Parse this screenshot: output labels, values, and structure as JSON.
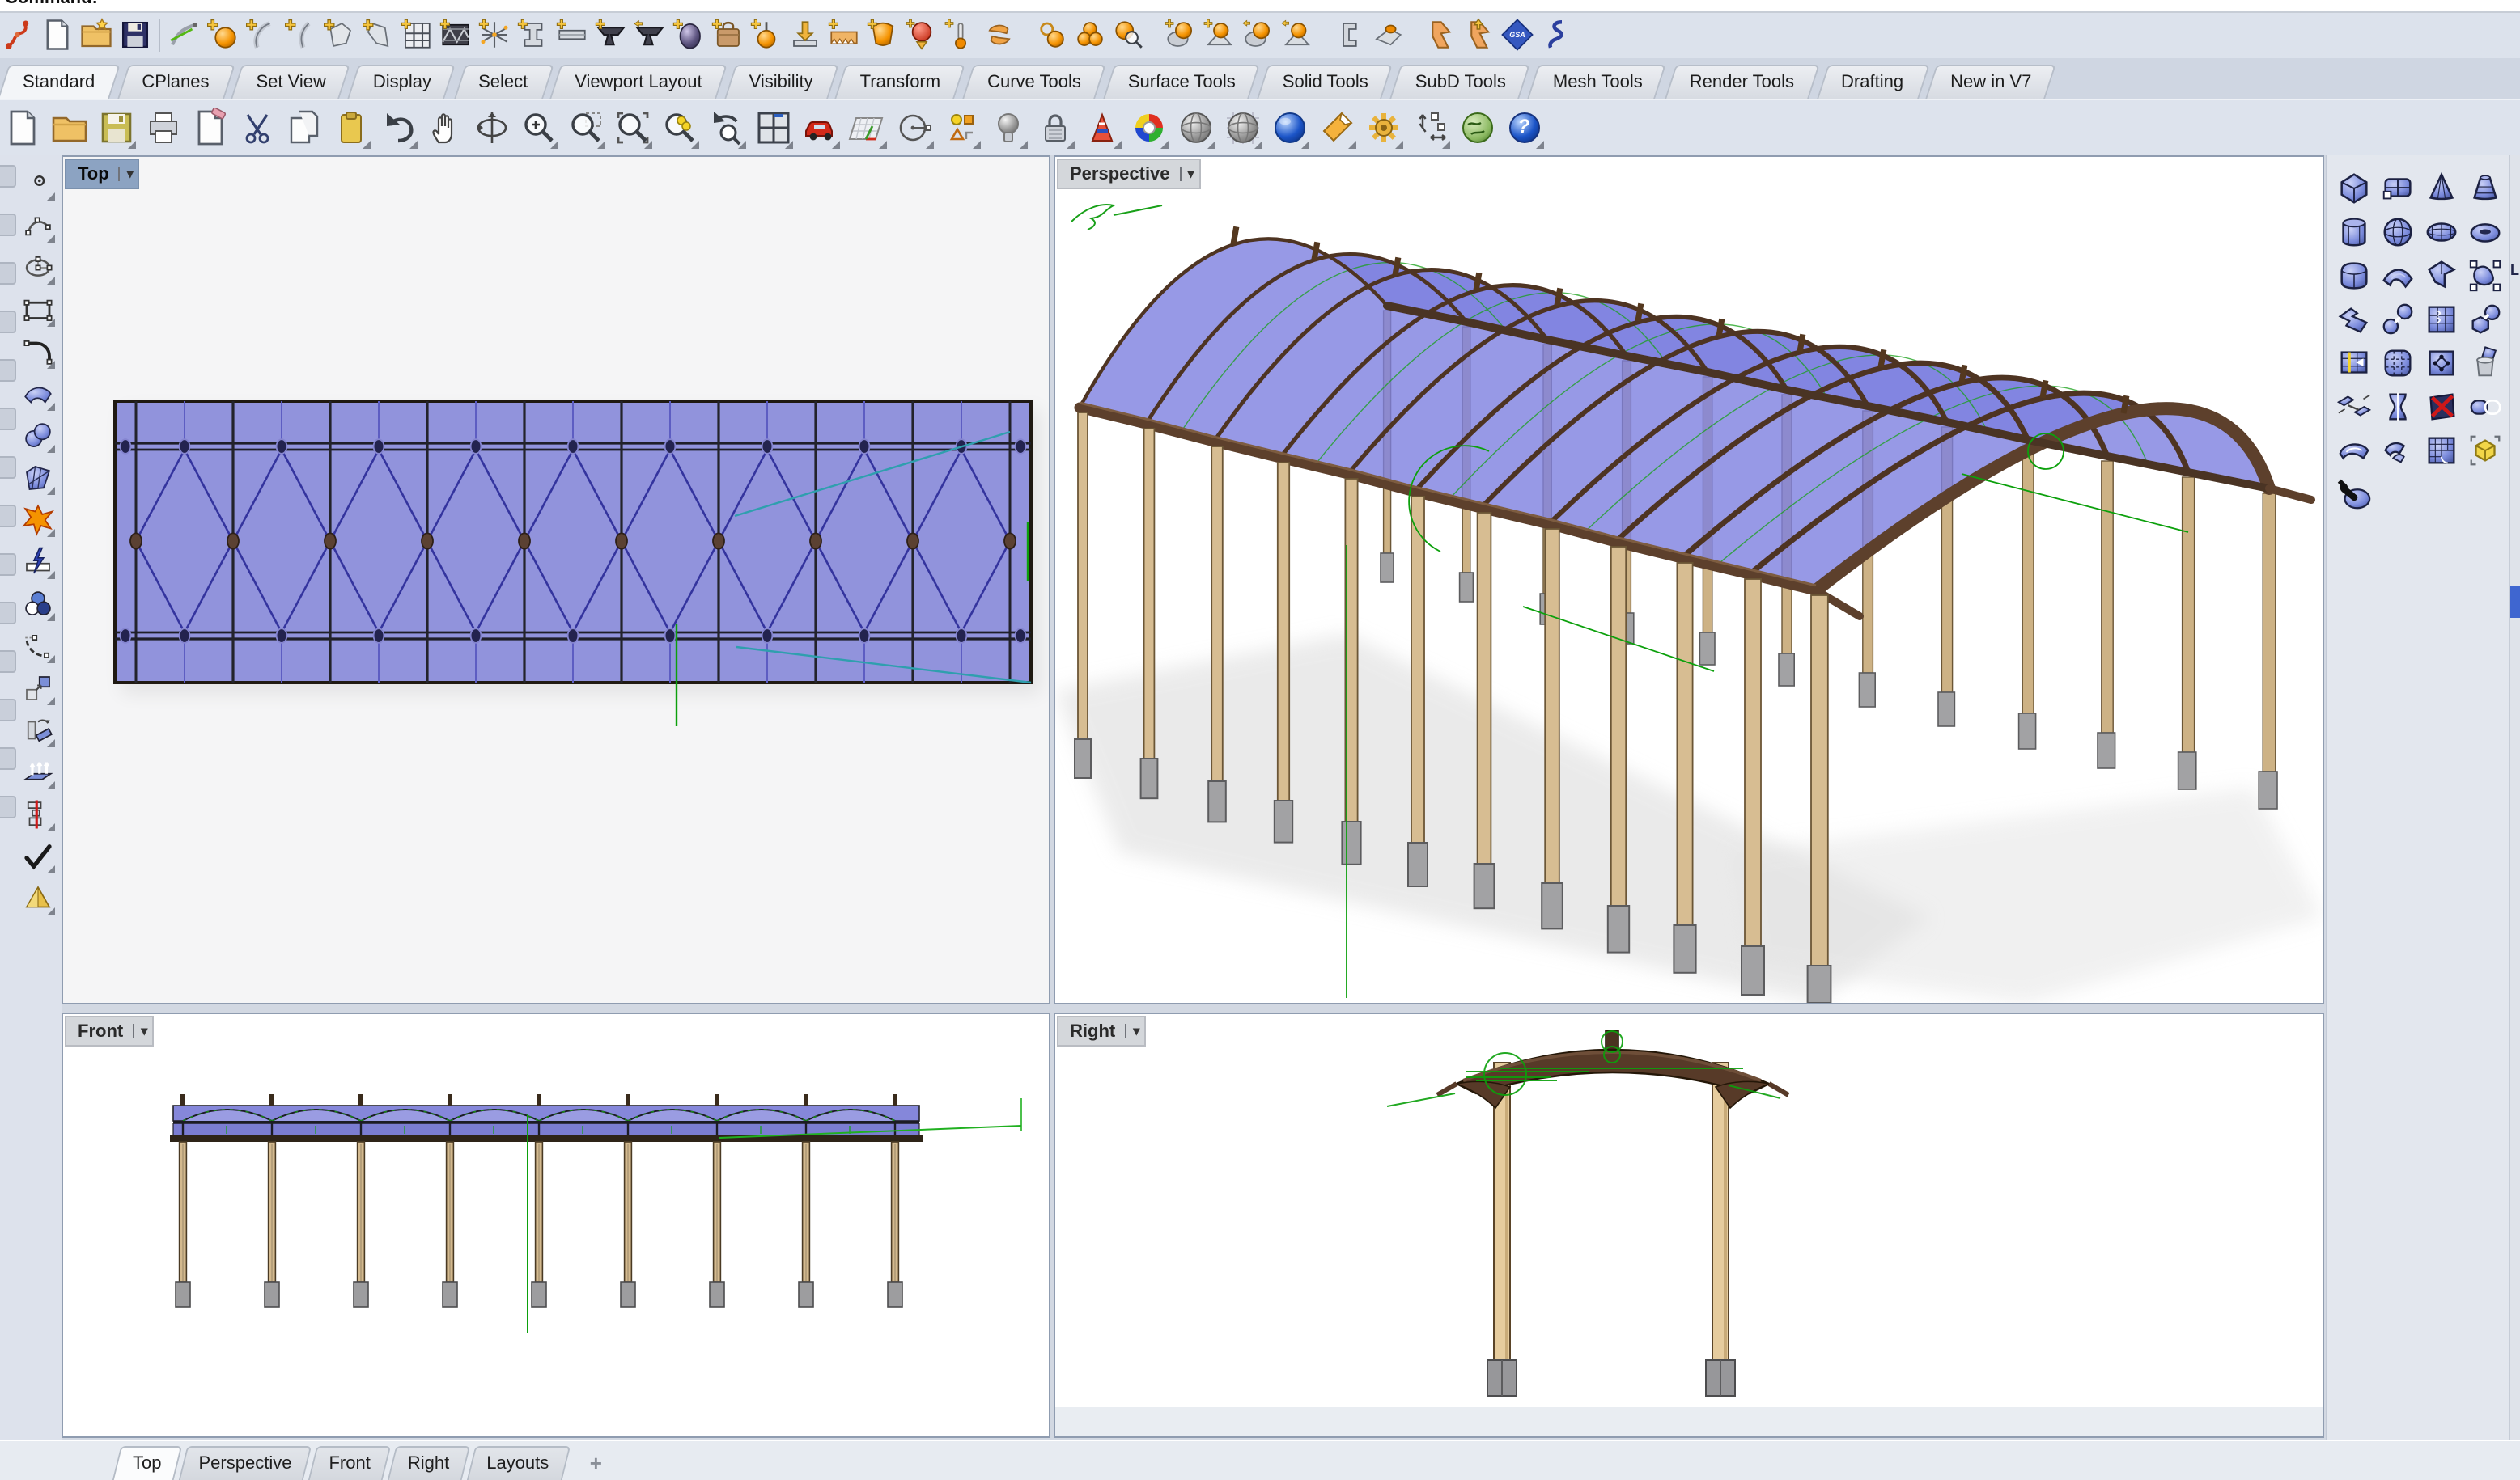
{
  "window": {
    "command_label": "Command:"
  },
  "ribbon": {
    "tabs": [
      {
        "label": "Standard",
        "active": true
      },
      {
        "label": "CPlanes"
      },
      {
        "label": "Set View"
      },
      {
        "label": "Display"
      },
      {
        "label": "Select"
      },
      {
        "label": "Viewport Layout"
      },
      {
        "label": "Visibility"
      },
      {
        "label": "Transform"
      },
      {
        "label": "Curve Tools"
      },
      {
        "label": "Surface Tools"
      },
      {
        "label": "Solid Tools"
      },
      {
        "label": "SubD Tools"
      },
      {
        "label": "Mesh Tools"
      },
      {
        "label": "Render Tools"
      },
      {
        "label": "Drafting"
      },
      {
        "label": "New in V7"
      }
    ]
  },
  "toolbar_row1": {
    "gsa_label": "GSA",
    "icons": [
      "red-plugin",
      "new-file",
      "open-folder",
      "save",
      "curve-edit",
      "point-add",
      "curve-add",
      "interp-curve-add",
      "polygon-add",
      "surface-add",
      "grid-frame-add",
      "truss-panel",
      "truss-network-add",
      "ibeam-add",
      "ibeam-profile-add",
      "anvil-add",
      "anvil-arrow",
      "purple-egg-add",
      "bag-add",
      "hanging-ball-add",
      "press-load",
      "serrated-plate-add",
      "shield-add",
      "red-ball-load",
      "thermometer-add",
      "recycle-arrows",
      "ring-ball",
      "three-balls",
      "ball-magnifier",
      "ball-disc-add",
      "ball-wedge-add",
      "ball-disc-arrow",
      "ball-wedge-arrow",
      "steel-section",
      "wedge-egg",
      "flag",
      "flag-up",
      "gsa",
      "etabs"
    ]
  },
  "toolbar_row2": {
    "help_glyph": "?",
    "icons": [
      "new-file",
      "open-folder",
      "save",
      "print",
      "clean-page",
      "cut",
      "copy",
      "paste",
      "undo",
      "pan",
      "rotate-view",
      "zoom-dynamic",
      "zoom-window",
      "zoom-selected",
      "zoom-extents",
      "zoom-undo",
      "viewport-layout",
      "car",
      "cplane",
      "circle-center",
      "object-snap-shapes",
      "lightbulb",
      "lock",
      "analysis-cone",
      "rendered-display",
      "shaded-display",
      "ghosted-display",
      "render",
      "spotlight",
      "gear-options",
      "dimension",
      "earth-render",
      "help"
    ]
  },
  "left_toolbar": {
    "icons": [
      "point",
      "control-point-curve",
      "ellipse",
      "rectangle",
      "fillet-curve",
      "surface",
      "spheres",
      "mesh",
      "explode",
      "split",
      "boolean-circles",
      "blend-curve",
      "copy-move",
      "rotate",
      "extrude-surface",
      "distribute",
      "check-selection",
      "pyramid"
    ]
  },
  "subd_panel": {
    "icons": [
      "subd-box",
      "subd-plane",
      "subd-cone",
      "subd-truncated-cone",
      "subd-cylinder",
      "subd-sphere",
      "subd-ellipsoid",
      "subd-torus",
      "subd-cube-rounded",
      "subd-surface-arch",
      "subd-surface-angle",
      "subd-control-points",
      "subd-pipe-elbow",
      "subd-to-nurbs",
      "subd-from-mesh",
      "subd-convert-cube",
      "subd-insert-edge",
      "subd-quad-grid",
      "subd-show-vertices",
      "subd-delete",
      "subd-bridge",
      "subd-stitch",
      "subd-delete-face",
      "subd-merge-edge",
      "subd-fill-hole",
      "subd-offset",
      "subd-mesh-corner",
      "subd-box-mode",
      "subd-repair-wrench"
    ]
  },
  "viewports": {
    "top": {
      "label": "Top",
      "dropdown_glyph": "▾",
      "active": true
    },
    "perspective": {
      "label": "Perspective",
      "dropdown_glyph": "▾",
      "active": false
    },
    "front": {
      "label": "Front",
      "dropdown_glyph": "▾",
      "active": false
    },
    "right": {
      "label": "Right",
      "dropdown_glyph": "▾",
      "active": false
    }
  },
  "bottom_tabs": {
    "tabs": [
      {
        "label": "Top",
        "active": true
      },
      {
        "label": "Perspective"
      },
      {
        "label": "Front"
      },
      {
        "label": "Right"
      },
      {
        "label": "Layouts"
      }
    ],
    "add_label": "+"
  },
  "edge": {
    "partial_text": "L"
  },
  "colors": {
    "glazing_blue": "#8f91dc",
    "frame_brown": "#53361f",
    "column_tan": "#d7bd92",
    "footing_gray": "#a2a2a4",
    "construction_green": "#0ca00c",
    "guide_teal": "#2f9fae",
    "active_label_bg": "#8ca3c2",
    "selection_blue": "#3f66d0"
  }
}
